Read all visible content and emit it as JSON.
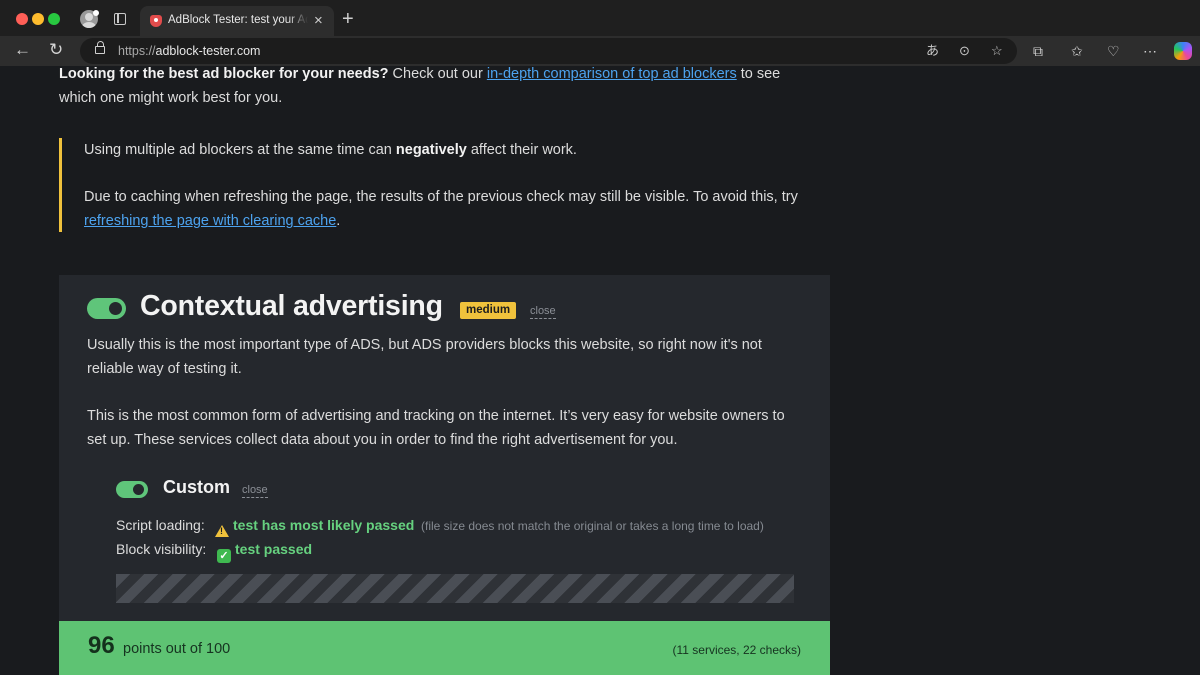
{
  "browser": {
    "tab_title": "AdBlock Tester: test your AdBlock",
    "url_protocol": "https://",
    "url_host": "adblock-tester.com"
  },
  "intro": {
    "lead": "Looking for the best ad blocker for your needs?",
    "before_link": " Check out our ",
    "link": "in-depth comparison of top ad blockers",
    "after_link": " to see which one might work best for you."
  },
  "notes": {
    "multiple_before": "Using multiple ad blockers at the same time can ",
    "multiple_bold": "negatively",
    "multiple_after": " affect their work.",
    "cache_text": "Due to caching when refreshing the page, the results of the previous check may still be visible. To avoid this, try ",
    "cache_link": "refreshing the page with clearing cache",
    "cache_end": "."
  },
  "section": {
    "title": "Contextual advertising",
    "badge": "medium",
    "close": "close",
    "desc1": "Usually this is the most important type of ADS, but ADS providers blocks this website, so right now it's not reliable way of testing it.",
    "desc2": "This is the most common form of advertising and tracking on the internet. It’s very easy for website owners to set up. These services collect data about you in order to find the right advertisement for you."
  },
  "subsection": {
    "title": "Custom",
    "close": "close",
    "script_label": "Script loading:",
    "script_result": "test has most likely passed",
    "script_note": "(file size does not match the original or takes a long time to load)",
    "block_label": "Block visibility:",
    "block_result": "test passed"
  },
  "score": {
    "points": "96",
    "text": "points out of 100",
    "meta": "(11 services, 22 checks)"
  },
  "colors": {
    "accent_green": "#5ec373",
    "badge_yellow": "#f0c23c",
    "link_blue": "#4da3ef"
  }
}
